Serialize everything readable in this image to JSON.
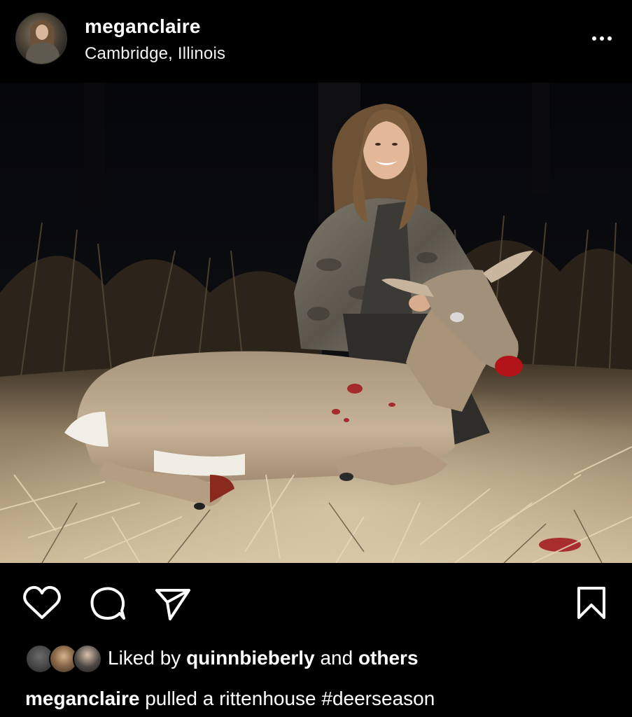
{
  "post": {
    "username": "meganclaire",
    "location": "Cambridge, Illinois",
    "more_icon": "more-horizontal-icon"
  },
  "actions": {
    "like_icon": "heart-icon",
    "comment_icon": "comment-icon",
    "share_icon": "send-icon",
    "save_icon": "bookmark-icon"
  },
  "likes": {
    "prefix": "Liked by",
    "user": "quinnbieberly",
    "and": "and",
    "others": "others"
  },
  "caption": {
    "username": "meganclaire",
    "text": "pulled a rittenhouse #deerseason"
  }
}
